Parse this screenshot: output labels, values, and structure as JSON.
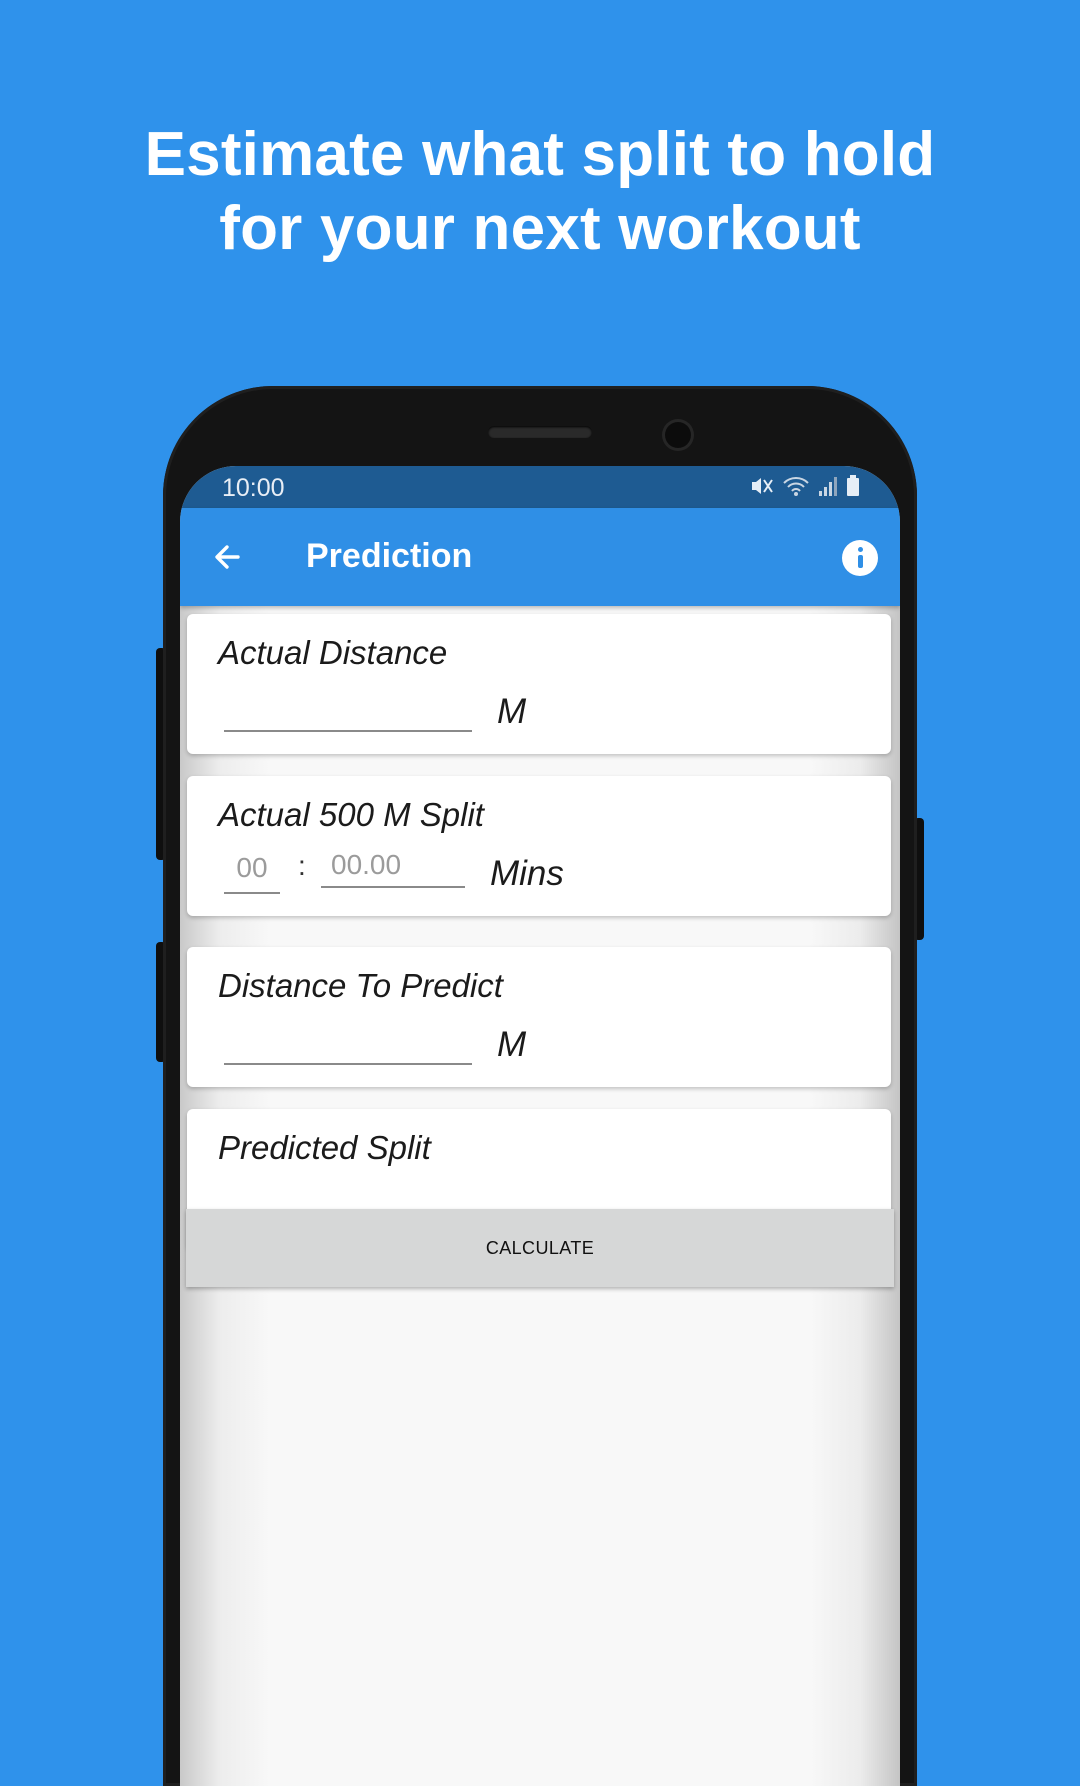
{
  "headline": {
    "line1": "Estimate what split to hold",
    "line2": "for your next workout"
  },
  "status_bar": {
    "time": "10:00",
    "icons": [
      "mute-icon",
      "wifi-icon",
      "signal-icon",
      "battery-icon"
    ]
  },
  "app_bar": {
    "title": "Prediction",
    "back_icon": "arrow-left-icon",
    "info_icon": "info-icon"
  },
  "cards": {
    "actual_distance": {
      "label": "Actual Distance",
      "value": "",
      "unit": "M"
    },
    "actual_split": {
      "label": "Actual 500 M Split",
      "minutes_placeholder": "00",
      "seconds_placeholder": "00.00",
      "separator": ":",
      "unit": "Mins"
    },
    "distance_to_predict": {
      "label": "Distance To Predict",
      "value": "",
      "unit": "M"
    },
    "predicted_split": {
      "label": "Predicted Split",
      "value": ""
    }
  },
  "calculate_button": {
    "label": "CALCULATE"
  },
  "colors": {
    "background": "#2f92eb",
    "app_bar": "#2f8fe6",
    "status_bar": "#1e5b92",
    "button": "#d6d7d7"
  }
}
